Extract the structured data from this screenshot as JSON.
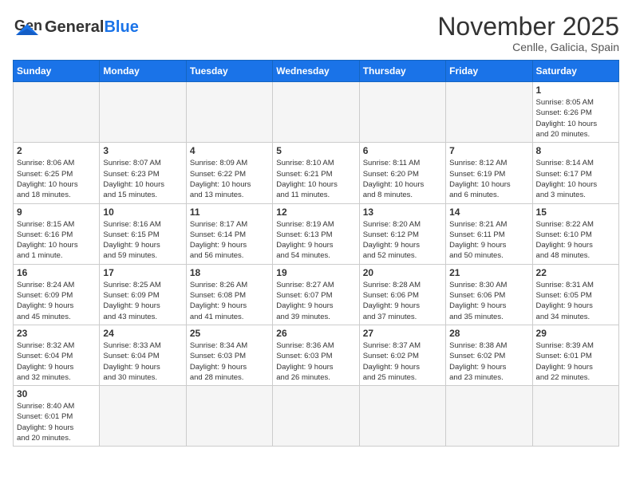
{
  "header": {
    "logo_text_normal": "General",
    "logo_text_colored": "Blue",
    "month_title": "November 2025",
    "location": "Cenlle, Galicia, Spain"
  },
  "weekdays": [
    "Sunday",
    "Monday",
    "Tuesday",
    "Wednesday",
    "Thursday",
    "Friday",
    "Saturday"
  ],
  "days": [
    {
      "date": null,
      "info": ""
    },
    {
      "date": null,
      "info": ""
    },
    {
      "date": null,
      "info": ""
    },
    {
      "date": null,
      "info": ""
    },
    {
      "date": null,
      "info": ""
    },
    {
      "date": null,
      "info": ""
    },
    {
      "date": "1",
      "info": "Sunrise: 8:05 AM\nSunset: 6:26 PM\nDaylight: 10 hours\nand 20 minutes."
    },
    {
      "date": "2",
      "info": "Sunrise: 8:06 AM\nSunset: 6:25 PM\nDaylight: 10 hours\nand 18 minutes."
    },
    {
      "date": "3",
      "info": "Sunrise: 8:07 AM\nSunset: 6:23 PM\nDaylight: 10 hours\nand 15 minutes."
    },
    {
      "date": "4",
      "info": "Sunrise: 8:09 AM\nSunset: 6:22 PM\nDaylight: 10 hours\nand 13 minutes."
    },
    {
      "date": "5",
      "info": "Sunrise: 8:10 AM\nSunset: 6:21 PM\nDaylight: 10 hours\nand 11 minutes."
    },
    {
      "date": "6",
      "info": "Sunrise: 8:11 AM\nSunset: 6:20 PM\nDaylight: 10 hours\nand 8 minutes."
    },
    {
      "date": "7",
      "info": "Sunrise: 8:12 AM\nSunset: 6:19 PM\nDaylight: 10 hours\nand 6 minutes."
    },
    {
      "date": "8",
      "info": "Sunrise: 8:14 AM\nSunset: 6:17 PM\nDaylight: 10 hours\nand 3 minutes."
    },
    {
      "date": "9",
      "info": "Sunrise: 8:15 AM\nSunset: 6:16 PM\nDaylight: 10 hours\nand 1 minute."
    },
    {
      "date": "10",
      "info": "Sunrise: 8:16 AM\nSunset: 6:15 PM\nDaylight: 9 hours\nand 59 minutes."
    },
    {
      "date": "11",
      "info": "Sunrise: 8:17 AM\nSunset: 6:14 PM\nDaylight: 9 hours\nand 56 minutes."
    },
    {
      "date": "12",
      "info": "Sunrise: 8:19 AM\nSunset: 6:13 PM\nDaylight: 9 hours\nand 54 minutes."
    },
    {
      "date": "13",
      "info": "Sunrise: 8:20 AM\nSunset: 6:12 PM\nDaylight: 9 hours\nand 52 minutes."
    },
    {
      "date": "14",
      "info": "Sunrise: 8:21 AM\nSunset: 6:11 PM\nDaylight: 9 hours\nand 50 minutes."
    },
    {
      "date": "15",
      "info": "Sunrise: 8:22 AM\nSunset: 6:10 PM\nDaylight: 9 hours\nand 48 minutes."
    },
    {
      "date": "16",
      "info": "Sunrise: 8:24 AM\nSunset: 6:09 PM\nDaylight: 9 hours\nand 45 minutes."
    },
    {
      "date": "17",
      "info": "Sunrise: 8:25 AM\nSunset: 6:09 PM\nDaylight: 9 hours\nand 43 minutes."
    },
    {
      "date": "18",
      "info": "Sunrise: 8:26 AM\nSunset: 6:08 PM\nDaylight: 9 hours\nand 41 minutes."
    },
    {
      "date": "19",
      "info": "Sunrise: 8:27 AM\nSunset: 6:07 PM\nDaylight: 9 hours\nand 39 minutes."
    },
    {
      "date": "20",
      "info": "Sunrise: 8:28 AM\nSunset: 6:06 PM\nDaylight: 9 hours\nand 37 minutes."
    },
    {
      "date": "21",
      "info": "Sunrise: 8:30 AM\nSunset: 6:06 PM\nDaylight: 9 hours\nand 35 minutes."
    },
    {
      "date": "22",
      "info": "Sunrise: 8:31 AM\nSunset: 6:05 PM\nDaylight: 9 hours\nand 34 minutes."
    },
    {
      "date": "23",
      "info": "Sunrise: 8:32 AM\nSunset: 6:04 PM\nDaylight: 9 hours\nand 32 minutes."
    },
    {
      "date": "24",
      "info": "Sunrise: 8:33 AM\nSunset: 6:04 PM\nDaylight: 9 hours\nand 30 minutes."
    },
    {
      "date": "25",
      "info": "Sunrise: 8:34 AM\nSunset: 6:03 PM\nDaylight: 9 hours\nand 28 minutes."
    },
    {
      "date": "26",
      "info": "Sunrise: 8:36 AM\nSunset: 6:03 PM\nDaylight: 9 hours\nand 26 minutes."
    },
    {
      "date": "27",
      "info": "Sunrise: 8:37 AM\nSunset: 6:02 PM\nDaylight: 9 hours\nand 25 minutes."
    },
    {
      "date": "28",
      "info": "Sunrise: 8:38 AM\nSunset: 6:02 PM\nDaylight: 9 hours\nand 23 minutes."
    },
    {
      "date": "29",
      "info": "Sunrise: 8:39 AM\nSunset: 6:01 PM\nDaylight: 9 hours\nand 22 minutes."
    },
    {
      "date": "30",
      "info": "Sunrise: 8:40 AM\nSunset: 6:01 PM\nDaylight: 9 hours\nand 20 minutes."
    }
  ]
}
